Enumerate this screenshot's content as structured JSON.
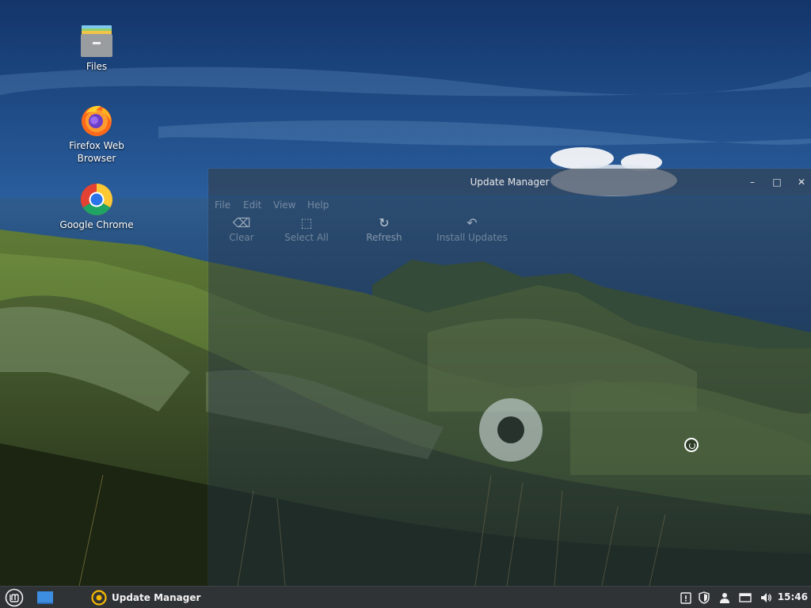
{
  "desktop": {
    "icons": [
      {
        "label": "Files",
        "icon": "folder-icon"
      },
      {
        "label": "Firefox Web\nBrowser",
        "label_line1": "Firefox Web",
        "label_line2": "Browser",
        "icon": "firefox-icon"
      },
      {
        "label": "Google Chrome",
        "icon": "chrome-icon"
      }
    ]
  },
  "window": {
    "title": "Update Manager",
    "controls": {
      "minimize": "–",
      "maximize": "□",
      "close": "✕"
    },
    "menu": [
      "File",
      "Edit",
      "View",
      "Help"
    ],
    "toolbar": [
      {
        "label": "Clear",
        "icon": "clear-icon"
      },
      {
        "label": "Select All",
        "icon": "select-all-icon"
      },
      {
        "label": "Refresh",
        "icon": "refresh-icon"
      },
      {
        "label": "Install Updates",
        "icon": "install-updates-icon"
      }
    ]
  },
  "taskbar": {
    "task_label": "Update Manager",
    "clock": "15:46",
    "tray_icons": [
      "update-notice-icon",
      "shield-icon",
      "user-icon",
      "network-icon",
      "volume-icon"
    ]
  },
  "colors": {
    "taskbar_bg": "#303336",
    "sky": "#1e4f8c",
    "hills": "#4e6a2e",
    "mint_green": "#8fc44a"
  }
}
